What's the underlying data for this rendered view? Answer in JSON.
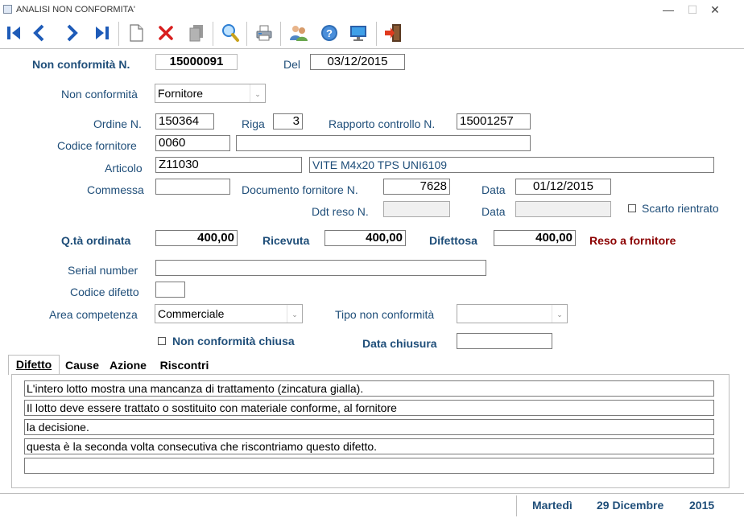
{
  "window": {
    "title": "ANALISI NON CONFORMITA'"
  },
  "toolbar": {
    "buttons": [
      {
        "icon": "first-record-icon"
      },
      {
        "icon": "previous-record-icon"
      },
      {
        "icon": "next-record-icon"
      },
      {
        "icon": "last-record-icon"
      },
      {
        "icon": "new-document-icon"
      },
      {
        "icon": "delete-icon"
      },
      {
        "icon": "copy-icon"
      },
      {
        "icon": "search-icon"
      },
      {
        "icon": "print-icon"
      },
      {
        "icon": "users-icon"
      },
      {
        "icon": "help-icon"
      },
      {
        "icon": "monitor-icon"
      },
      {
        "icon": "exit-icon"
      }
    ]
  },
  "form": {
    "nc_number_label": "Non conformità N.",
    "nc_number": "15000091",
    "del_label": "Del",
    "del_date": "03/12/2015",
    "nc_type_label": "Non conformità",
    "nc_type_value": "Fornitore",
    "order_label": "Ordine N.",
    "order_value": "150364",
    "row_label": "Riga",
    "row_value": "3",
    "report_label": "Rapporto controllo N.",
    "report_value": "15001257",
    "supplier_code_label": "Codice fornitore",
    "supplier_code_value": "0060",
    "supplier_name_value": "",
    "article_label": "Articolo",
    "article_code": "Z11030",
    "article_desc": "VITE M4x20 TPS UNI6109",
    "job_label": "Commessa",
    "job_value": "",
    "supplier_doc_label": "Documento fornitore N.",
    "supplier_doc_value": "7628",
    "data_label": "Data",
    "supplier_doc_date": "01/12/2015",
    "ddt_label": "Ddt reso N.",
    "ddt_value": "",
    "ddt_date": "",
    "scarto_label": "Scarto rientrato",
    "qty_ordered_label": "Q.tà  ordinata",
    "qty_ordered": "400,00",
    "qty_received_label": "Ricevuta",
    "qty_received": "400,00",
    "qty_defective_label": "Difettosa",
    "qty_defective": "400,00",
    "return_note": "Reso a fornitore",
    "serial_label": "Serial number",
    "serial_value": "",
    "defect_code_label": "Codice difetto",
    "defect_code_value": "",
    "area_label": "Area competenza",
    "area_value": "Commerciale",
    "nc_kind_label": "Tipo non conformità",
    "nc_kind_value": "",
    "closed_label": "Non conformità chiusa",
    "close_date_label": "Data chiusura",
    "close_date_value": ""
  },
  "tabs": [
    {
      "label": "Difetto"
    },
    {
      "label": "Cause"
    },
    {
      "label": "Azione"
    },
    {
      "label": "Riscontri"
    }
  ],
  "defect_lines": [
    "L'intero lotto mostra una mancanza di trattamento (zincatura gialla).",
    "Il lotto deve essere trattato o sostituito con materiale conforme, al fornitore",
    "la decisione.",
    "questa è la seconda volta consecutiva che riscontriamo questo difetto.",
    ""
  ],
  "status": {
    "day": "Martedì",
    "date": "29 Dicembre",
    "year": "2015"
  },
  "colors": {
    "label": "#1f4e79",
    "accent_red": "#8b0000",
    "nav_blue": "#1e5bb8"
  }
}
